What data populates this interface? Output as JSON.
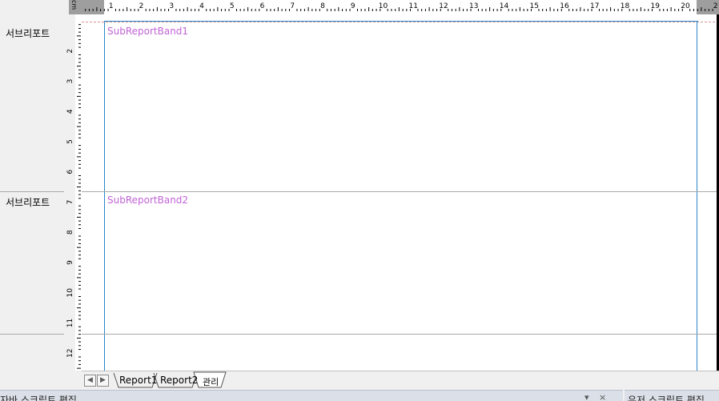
{
  "bands": [
    {
      "label": "서브리포트",
      "name": "SubReportBand1"
    },
    {
      "label": "서브리포트",
      "name": "SubReportBand2"
    }
  ],
  "ruler": {
    "unit_label": "cm",
    "h_numbers": [
      "1",
      "2",
      "3",
      "4",
      "5",
      "6",
      "7",
      "8",
      "9",
      "10",
      "11",
      "12",
      "13",
      "14",
      "15",
      "16",
      "17",
      "18",
      "19",
      "20",
      "2"
    ],
    "v_numbers": [
      "2",
      "3",
      "4",
      "5",
      "6",
      "7",
      "8",
      "9",
      "10",
      "11",
      "12"
    ]
  },
  "tabs": [
    {
      "label": "Report1"
    },
    {
      "label": "Report2"
    },
    {
      "label": "관리"
    }
  ],
  "nav": {
    "prev_icon": "chevron-left-icon",
    "next_icon": "chevron-right-icon"
  },
  "panes": {
    "left_title": "자바 스크립트 편집",
    "right_title": "유저 스크립트 편집"
  },
  "colors": {
    "margin_line": "#2a86c8",
    "band_name": "#c264d6"
  }
}
